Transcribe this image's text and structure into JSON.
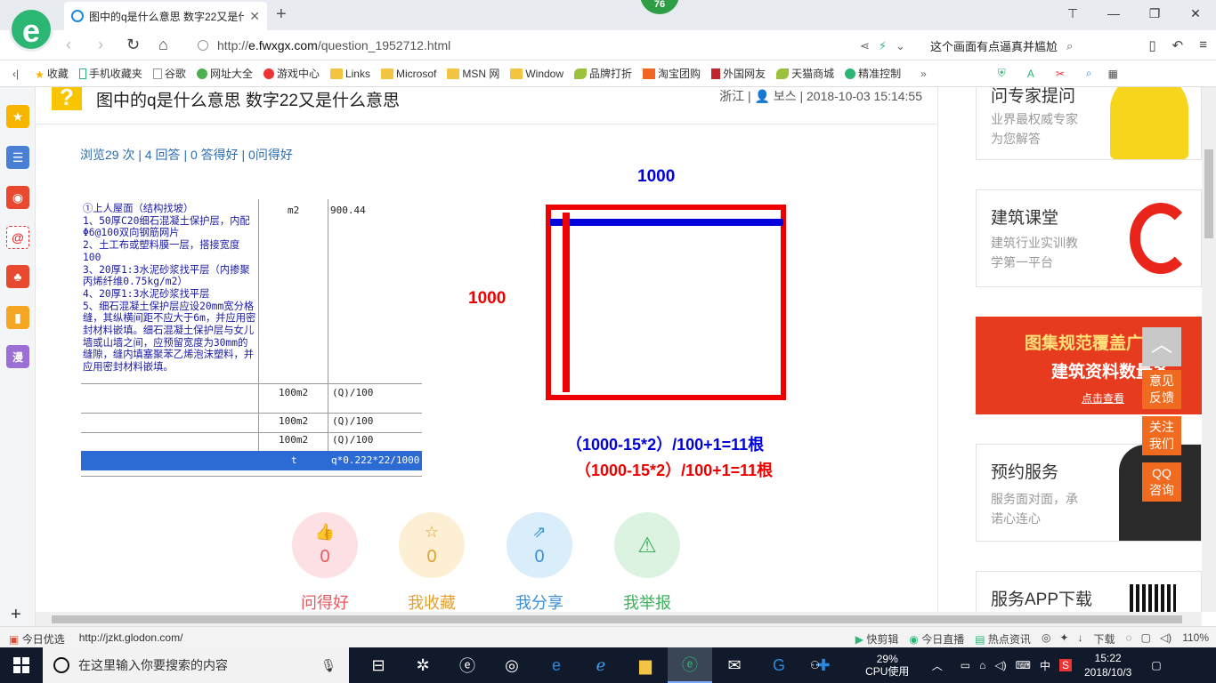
{
  "browser": {
    "logo_letter": "e",
    "tab_title": "图中的q是什么意思 数字22又是什么意思",
    "new_tab": "+",
    "badge": "76",
    "url_prefix": "http://",
    "url_domain": "e.fwxgx.com",
    "url_path": "/question_1952712.html",
    "url_hint": "这个画面有点逼真并尴尬",
    "controls": {
      "minimize": "—",
      "maximize": "❐",
      "close": "✕"
    }
  },
  "bookmarks": [
    {
      "label": "收藏",
      "icon": "star"
    },
    {
      "label": "手机收藏夹",
      "icon": "phone"
    },
    {
      "label": "谷歌",
      "icon": "page"
    },
    {
      "label": "网址大全",
      "icon": "globe"
    },
    {
      "label": "游戏中心",
      "icon": "game"
    },
    {
      "label": "Links",
      "icon": "folder"
    },
    {
      "label": "Microsof",
      "icon": "folder"
    },
    {
      "label": "MSN 网",
      "icon": "folder"
    },
    {
      "label": "Window",
      "icon": "folder"
    },
    {
      "label": "品牌打折",
      "icon": "leaf"
    },
    {
      "label": "淘宝团购",
      "icon": "taobao"
    },
    {
      "label": "外国网友",
      "icon": "bookmark"
    },
    {
      "label": "天猫商城",
      "icon": "leaf"
    },
    {
      "label": "精准控制",
      "icon": "wechat"
    }
  ],
  "sidebar": {
    "items": [
      {
        "name": "favorites",
        "glyph": "★",
        "color": "#f7b500"
      },
      {
        "name": "news",
        "glyph": "☰",
        "color": "#4a7fd6"
      },
      {
        "name": "weibo",
        "glyph": "◉",
        "color": "#e8492f"
      },
      {
        "name": "mail",
        "glyph": "@",
        "color": "#f0f0f0"
      },
      {
        "name": "game",
        "glyph": "♣",
        "color": "#e8492f"
      },
      {
        "name": "book",
        "glyph": "▮",
        "color": "#f5a623"
      },
      {
        "name": "comic",
        "glyph": "漫",
        "color": "#9b6fd6"
      }
    ],
    "add": "+"
  },
  "question": {
    "icon": "?",
    "title": "图中的q是什么意思 数字22又是什么意思",
    "meta": "浙江 | 👤 보스 | 2018-10-03 15:14:55",
    "stats": "浏览29 次 | 4 回答 | 0 答得好 | 0问得好"
  },
  "table_image": {
    "description": "①上人屋面（结构找坡）\n1、50厚C20细石混凝土保护层，内配Φ6@100双向钢筋网片\n2、土工布或塑料膜一层，搭接宽度100\n3、20厚1:3水泥砂浆找平层（内掺聚丙烯纤维0.75kg/m2）\n4、20厚1:3水泥砂浆找平层\n5、细石混凝土保护层应设20mm宽分格缝，其纵横间距不应大于6m，并应用密封材料嵌填。细石混凝土保护层与女儿墙或山墙之间，应预留宽度为30mm的缝隙，缝内填塞聚苯乙烯泡沫塑料，并应用密封材料嵌填。",
    "unit1": "m2",
    "qty1": "900.44",
    "rows": [
      {
        "unit": "100m2",
        "expr": "(Q)/100"
      },
      {
        "unit": "100m2",
        "expr": "(Q)/100"
      },
      {
        "unit": "100m2",
        "expr": "(Q)/100"
      }
    ],
    "blue_row": {
      "unit": "t",
      "expr": "q*0.222*22/1000"
    }
  },
  "diagram": {
    "top_label": "1000",
    "left_label": "1000",
    "formula_blue": "（1000-15*2）/100+1=11根",
    "formula_red": "（1000-15*2）/100+1=11根",
    "colors": {
      "red": "#ee0000",
      "blue": "#0000dd"
    }
  },
  "actions": [
    {
      "label": "问得好",
      "count": "0",
      "icon": "👍",
      "bg": "#fde0e3",
      "fg": "#e8585e"
    },
    {
      "label": "我收藏",
      "count": "0",
      "icon": "☆",
      "bg": "#fdefd3",
      "fg": "#e0a030"
    },
    {
      "label": "我分享",
      "count": "0",
      "icon": "⇗",
      "bg": "#d9edfb",
      "fg": "#3b8fd9"
    },
    {
      "label": "我举报",
      "count": "",
      "icon": "⚠",
      "bg": "#dcf3e2",
      "fg": "#3cb05a"
    }
  ],
  "right_cards": [
    {
      "title": "问专家提问",
      "line1": "业界最权威专家",
      "line2": "为您解答"
    },
    {
      "title": "建筑课堂",
      "line1": "建筑行业实训教",
      "line2": "学第一平台"
    },
    {
      "title": "预约服务",
      "line1": "服务面对面，承",
      "line2": "诺心连心"
    },
    {
      "title": "服务APP下载",
      "line1": "",
      "line2": ""
    }
  ],
  "banner": {
    "line1": "图集规范覆盖广",
    "line2": "建筑资料数量多",
    "cta": "点击查看"
  },
  "float_buttons": [
    {
      "label": "意见\n反馈"
    },
    {
      "label": "关注\n我们"
    },
    {
      "label": "QQ\n咨询"
    }
  ],
  "statusbar": {
    "left1": "今日优选",
    "left2": "http://jzkt.glodon.com/",
    "right": [
      "快剪辑",
      "今日直播",
      "热点资讯",
      "下载",
      "110%"
    ]
  },
  "taskbar": {
    "search_placeholder": "在这里输入你要搜索的内容",
    "cpu_value": "29%",
    "cpu_label": "CPU使用",
    "ime": "中",
    "time": "15:22",
    "date": "2018/10/3"
  }
}
